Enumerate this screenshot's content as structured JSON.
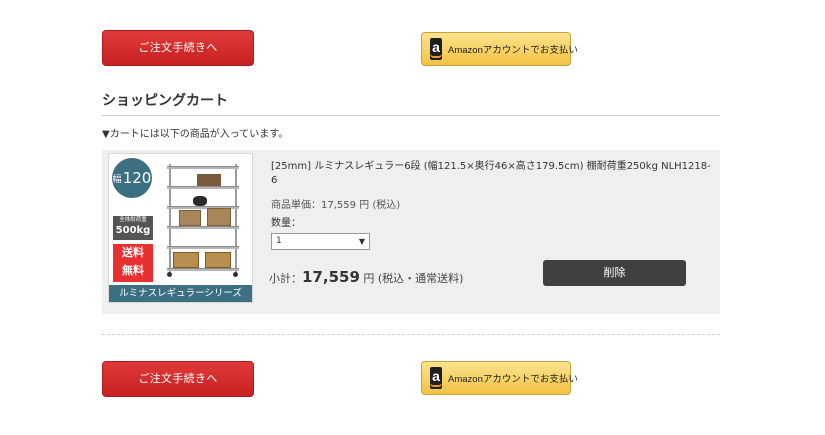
{
  "checkout": {
    "label": "ご注文手続きへ"
  },
  "amazon": {
    "label": "Amazonアカウントでお支払い"
  },
  "cart": {
    "heading": "ショッピングカート",
    "notice": "▼カートには以下の商品が入っています。"
  },
  "item": {
    "image": {
      "width_prefix": "幅",
      "width_value": "120",
      "load_line1": "全体耐荷重",
      "load_line2": "500kg",
      "shipping_line1": "送料",
      "shipping_line2": "無料",
      "series": "ルミナスレギュラーシリーズ"
    },
    "name": "[25mm] ルミナスレギュラー6段 (幅121.5×奥行46×高さ179.5cm) 棚耐荷重250kg NLH1218-6",
    "unit_price": "商品単価：17,559 円 (税込)",
    "quantity_label": "数量：",
    "quantity_value": "1",
    "subtotal_label": "小計：",
    "subtotal_amount": "17,559",
    "subtotal_note": " 円 (税込・通常送料)",
    "delete_label": "削除"
  }
}
